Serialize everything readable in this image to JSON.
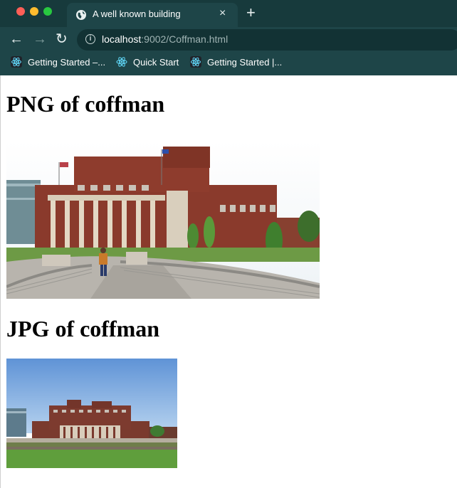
{
  "browser": {
    "tab": {
      "title": "A well known building",
      "close_glyph": "×",
      "icon": "globe-icon"
    },
    "new_tab_glyph": "+",
    "nav": {
      "back_glyph": "←",
      "forward_glyph": "→",
      "reload_glyph": "↻"
    },
    "address": {
      "host": "localhost",
      "rest": ":9002/Coffman.html",
      "info_glyph": "i"
    },
    "bookmarks": [
      {
        "label": "Getting Started –...",
        "icon": "react-icon"
      },
      {
        "label": "Quick Start",
        "icon": "react-icon"
      },
      {
        "label": "Getting Started |...",
        "icon": "react-icon"
      }
    ],
    "colors": {
      "tabbar": "#173a3c",
      "toolbar": "#1e4548",
      "omnibox": "#123234"
    }
  },
  "page": {
    "png_heading": "PNG of coffman",
    "jpg_heading": "JPG of coffman",
    "png_image": "photo-icon",
    "jpg_image": "photo-icon"
  }
}
